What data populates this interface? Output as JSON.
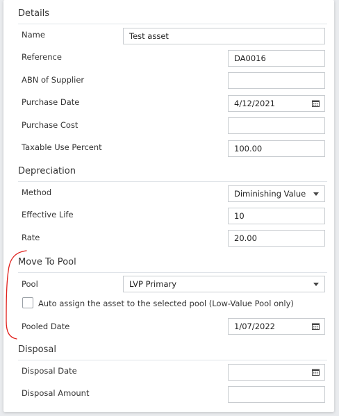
{
  "details": {
    "title": "Details",
    "name_label": "Name",
    "name_value": "Test asset",
    "reference_label": "Reference",
    "reference_value": "DA0016",
    "abn_label": "ABN of Supplier",
    "abn_value": "",
    "purchase_date_label": "Purchase Date",
    "purchase_date_value": "4/12/2021",
    "purchase_cost_label": "Purchase Cost",
    "purchase_cost_value": "",
    "taxable_use_label": "Taxable Use Percent",
    "taxable_use_value": "100.00"
  },
  "depreciation": {
    "title": "Depreciation",
    "method_label": "Method",
    "method_value": "Diminishing Value",
    "effective_life_label": "Effective Life",
    "effective_life_value": "10",
    "rate_label": "Rate",
    "rate_value": "20.00"
  },
  "move_to_pool": {
    "title": "Move To Pool",
    "pool_label": "Pool",
    "pool_value": "LVP Primary",
    "auto_assign_label": "Auto assign the asset to the selected pool (Low-Value Pool only)",
    "auto_assign_checked": false,
    "pooled_date_label": "Pooled Date",
    "pooled_date_value": "1/07/2022"
  },
  "disposal": {
    "title": "Disposal",
    "disposal_date_label": "Disposal Date",
    "disposal_date_value": "",
    "disposal_amount_label": "Disposal Amount",
    "disposal_amount_value": ""
  },
  "icons": {
    "calendar": "calendar-icon",
    "dropdown": "chevron-down-icon"
  },
  "colors": {
    "annotation": "#e0201c",
    "border": "#c8ccd0",
    "divider": "#dfe3e8"
  }
}
